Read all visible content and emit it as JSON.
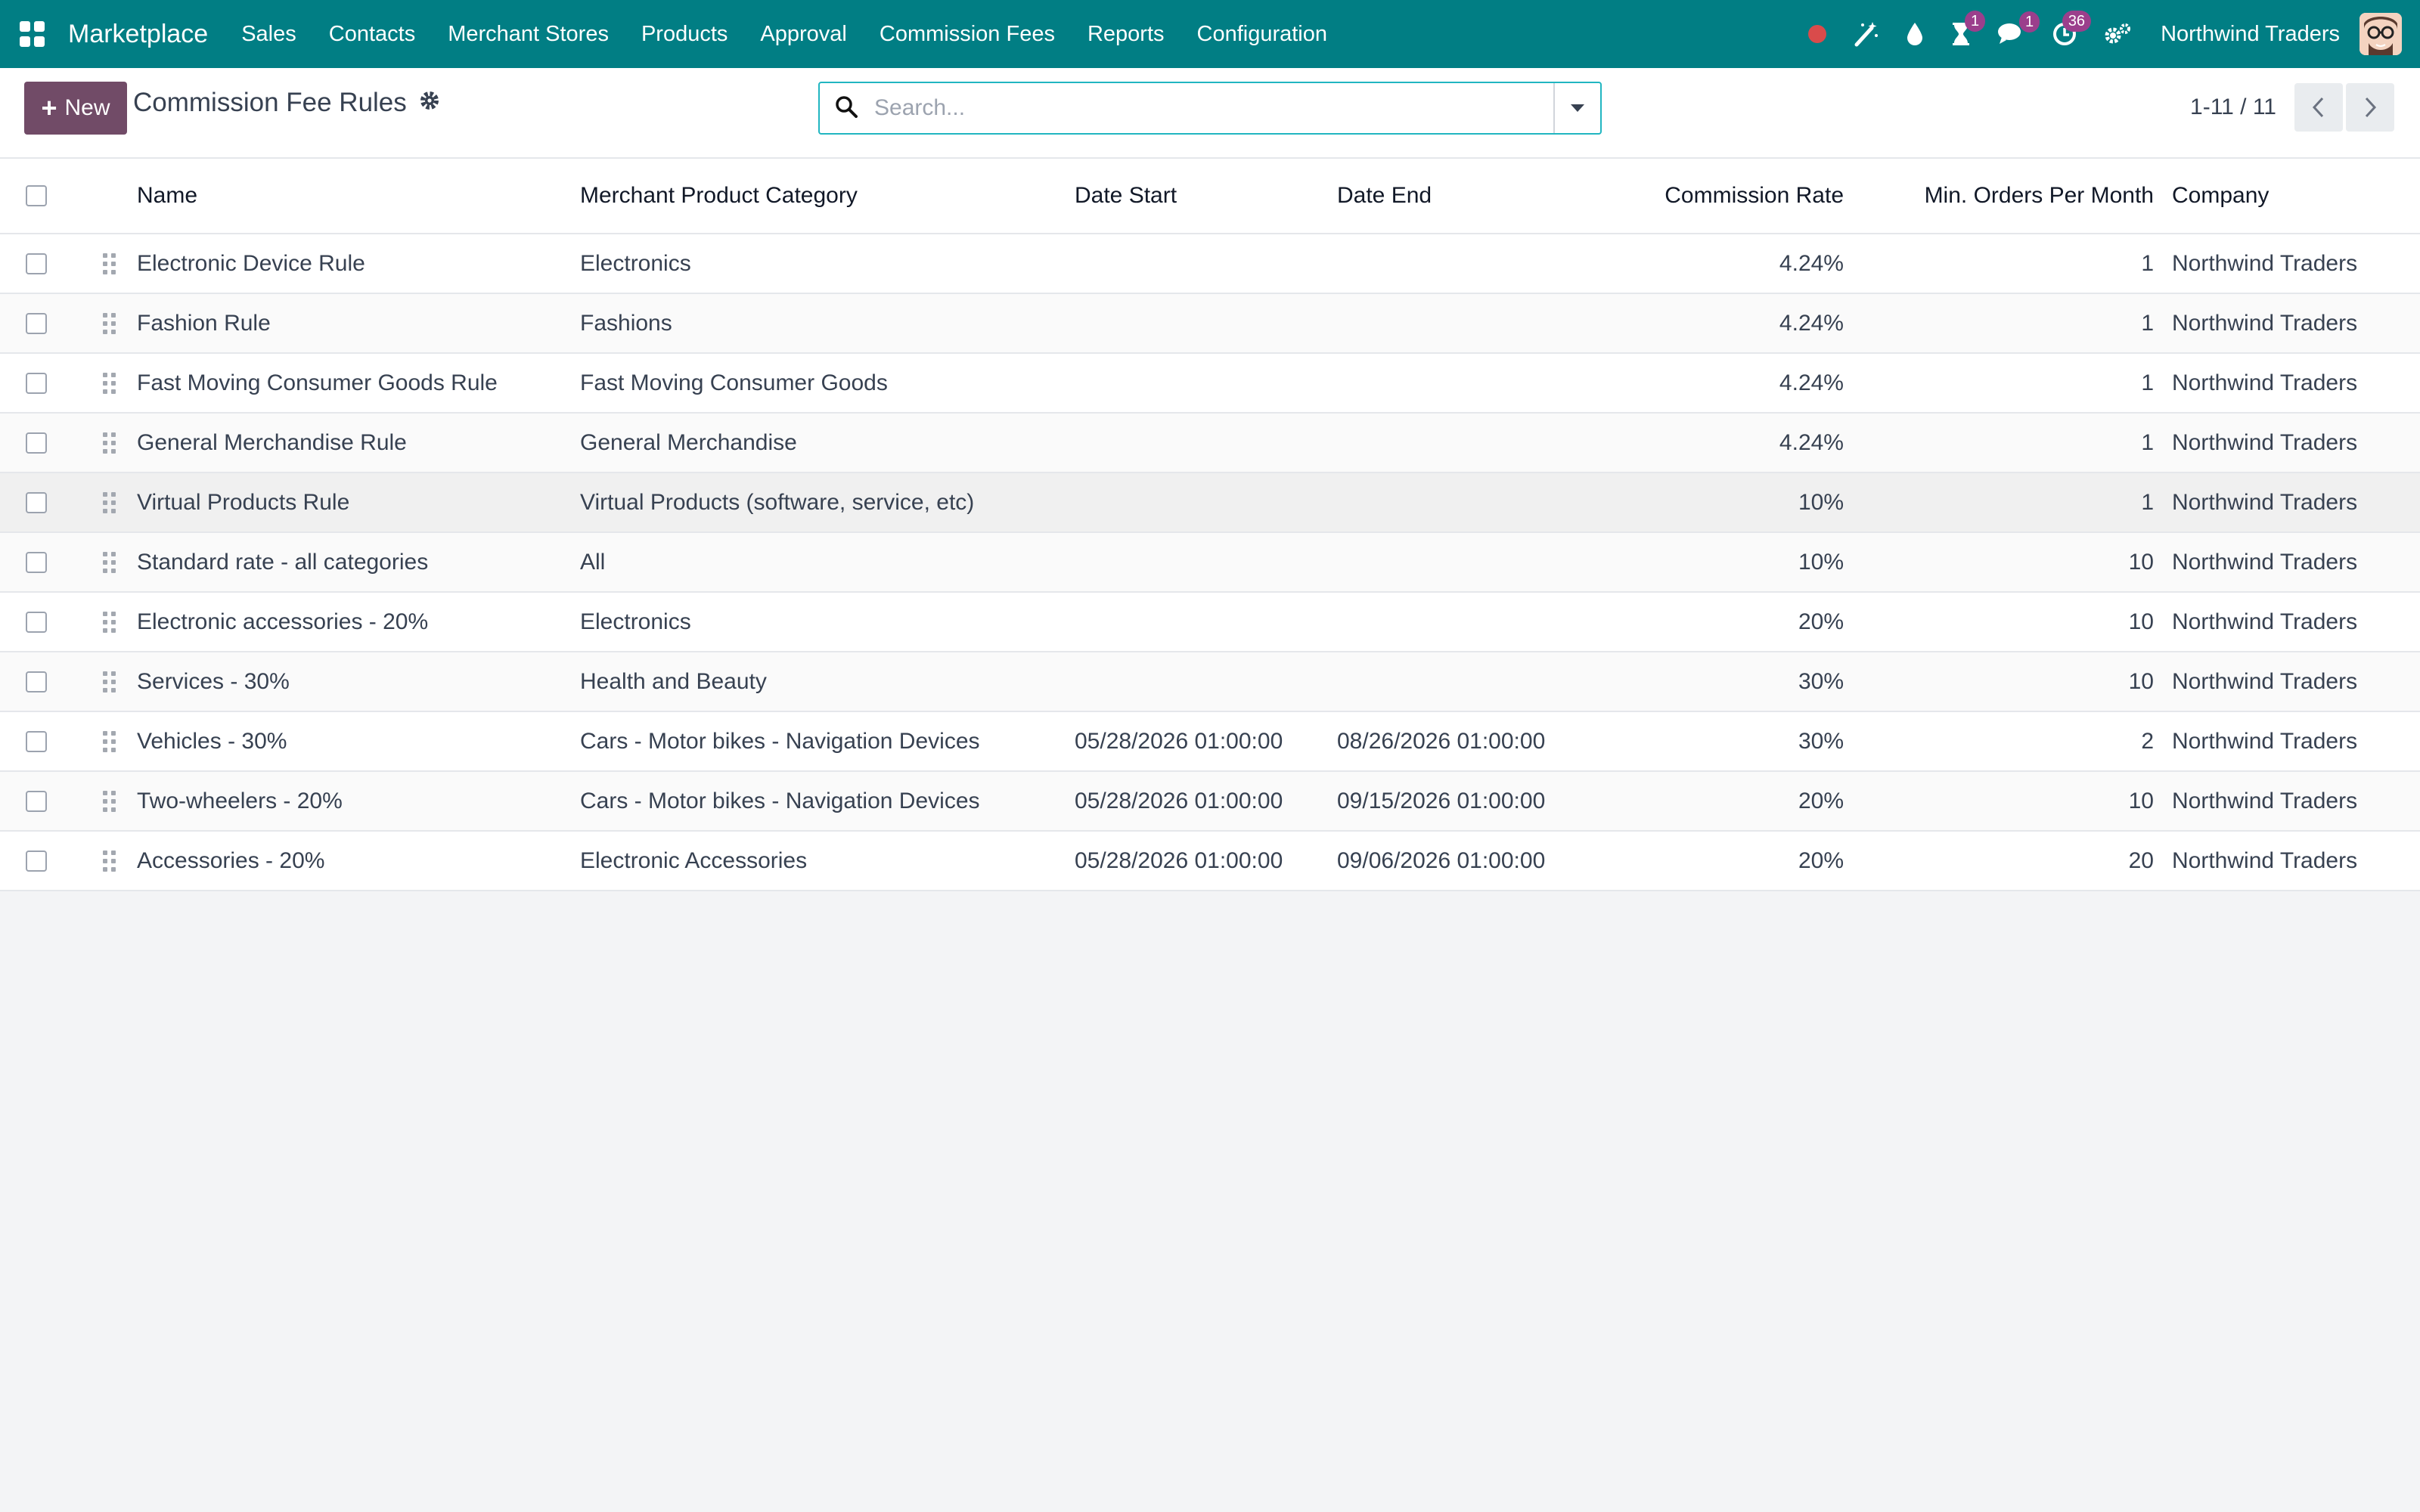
{
  "navbar": {
    "brand": "Marketplace",
    "menu": [
      "Sales",
      "Contacts",
      "Merchant Stores",
      "Products",
      "Approval",
      "Commission Fees",
      "Reports",
      "Configuration"
    ],
    "badges": {
      "activity": "1",
      "messages": "1",
      "clock": "36"
    },
    "company": "Northwind Traders",
    "accent_color": "#017e84"
  },
  "control_panel": {
    "new_label": "New",
    "title": "Commission Fee Rules",
    "search_placeholder": "Search...",
    "pager": "1-11 / 11"
  },
  "table": {
    "columns": [
      "Name",
      "Merchant Product Category",
      "Date Start",
      "Date End",
      "Commission Rate",
      "Min. Orders Per Month",
      "Company"
    ],
    "rows": [
      [
        "Electronic Device Rule",
        "Electronics",
        "",
        "",
        "4.24%",
        "1",
        "Northwind Traders"
      ],
      [
        "Fashion Rule",
        "Fashions",
        "",
        "",
        "4.24%",
        "1",
        "Northwind Traders"
      ],
      [
        "Fast Moving Consumer Goods Rule",
        "Fast Moving Consumer Goods",
        "",
        "",
        "4.24%",
        "1",
        "Northwind Traders"
      ],
      [
        "General Merchandise Rule",
        "General Merchandise",
        "",
        "",
        "4.24%",
        "1",
        "Northwind Traders"
      ],
      [
        "Virtual Products Rule",
        "Virtual Products (software, service, etc)",
        "",
        "",
        "10%",
        "1",
        "Northwind Traders"
      ],
      [
        "Standard rate - all categories",
        "All",
        "",
        "",
        "10%",
        "10",
        "Northwind Traders"
      ],
      [
        "Electronic accessories - 20%",
        "Electronics",
        "",
        "",
        "20%",
        "10",
        "Northwind Traders"
      ],
      [
        "Services - 30%",
        "Health and Beauty",
        "",
        "",
        "30%",
        "10",
        "Northwind Traders"
      ],
      [
        "Vehicles - 30%",
        "Cars - Motor bikes - Navigation Devices",
        "05/28/2026 01:00:00",
        "08/26/2026 01:00:00",
        "30%",
        "2",
        "Northwind Traders"
      ],
      [
        "Two-wheelers - 20%",
        "Cars - Motor bikes - Navigation Devices",
        "05/28/2026 01:00:00",
        "09/15/2026 01:00:00",
        "20%",
        "10",
        "Northwind Traders"
      ],
      [
        "Accessories - 20%",
        "Electronic Accessories",
        "05/28/2026 01:00:00",
        "09/06/2026 01:00:00",
        "20%",
        "20",
        "Northwind Traders"
      ]
    ]
  }
}
